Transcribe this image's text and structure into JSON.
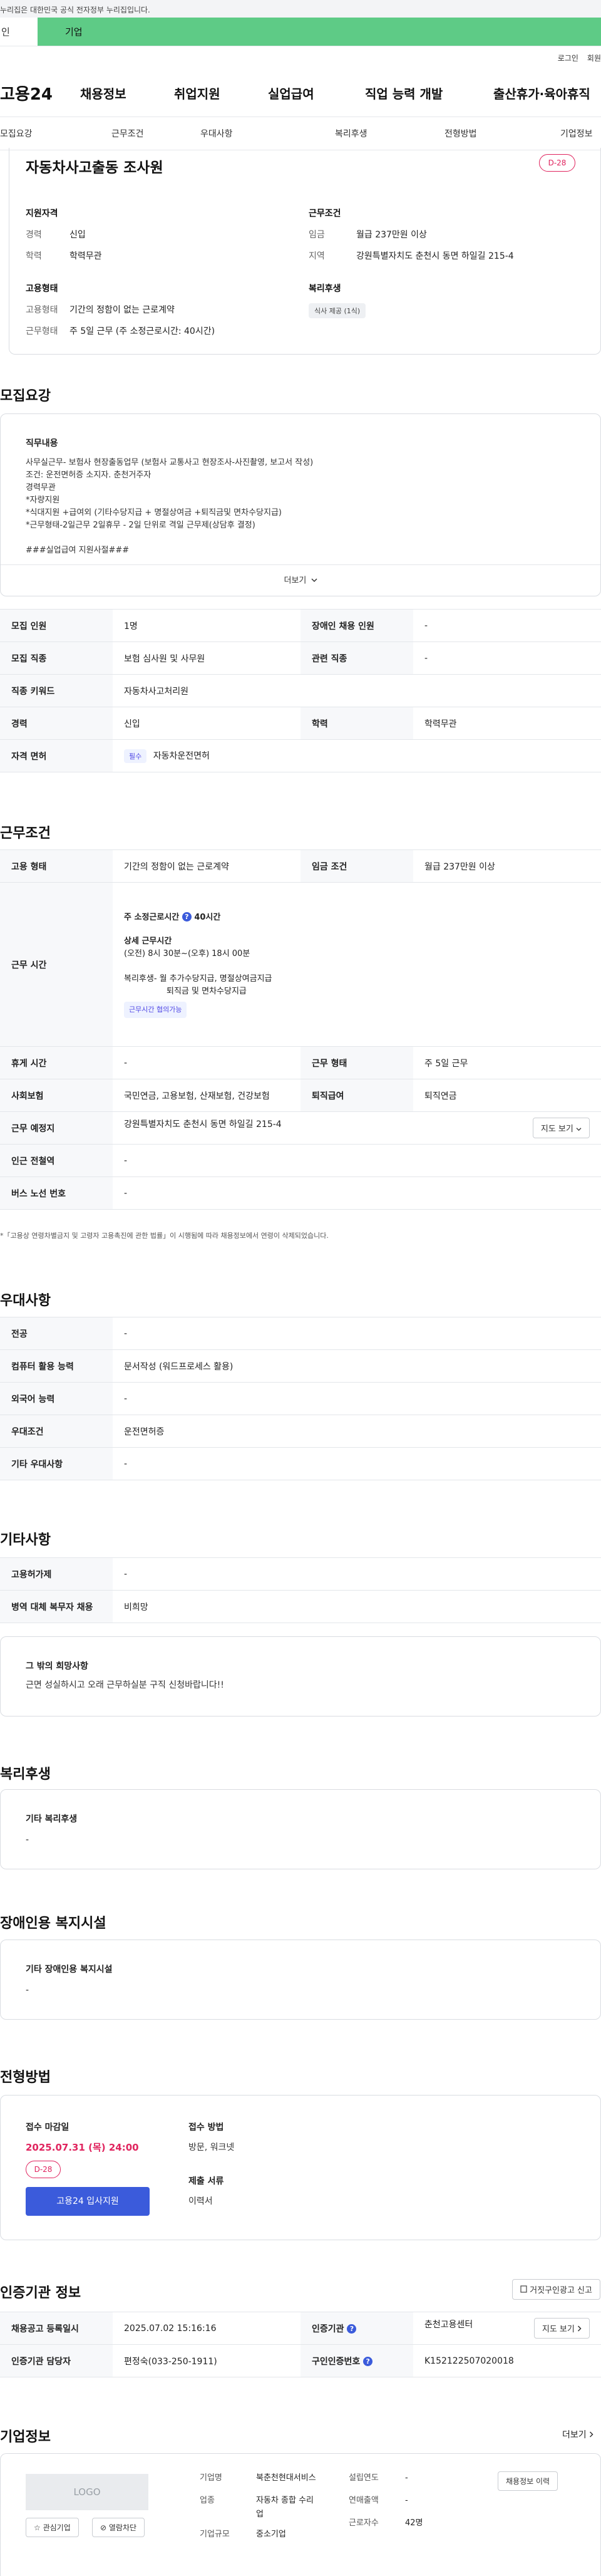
{
  "gov_notice": "누리집은 대한민국 공식 전자정부 누리집입니다.",
  "top_tabs": {
    "individual": "인",
    "company": "기업"
  },
  "util": {
    "login": "로그인",
    "join": "회원"
  },
  "gnb": {
    "logo": "고용24",
    "items": [
      "채용정보",
      "취업지원",
      "실업급여",
      "직업 능력 개발",
      "출산휴가·육아휴직"
    ]
  },
  "subnav": [
    "모집요강",
    "근무조건",
    "우대사항",
    "복리후생",
    "전형방법",
    "기업정보"
  ],
  "summary": {
    "title": "자동차사고출동 조사원",
    "dday": "D-28",
    "qual": {
      "heading": "지원자격",
      "rows": [
        {
          "k": "경력",
          "v": "신입"
        },
        {
          "k": "학력",
          "v": "학력무관"
        }
      ]
    },
    "cond": {
      "heading": "근무조건",
      "rows": [
        {
          "k": "임금",
          "v": "월급 237만원 이상"
        },
        {
          "k": "지역",
          "v": "강원특별자치도 춘천시 동면 하일길 215-4"
        }
      ]
    },
    "employ": {
      "heading": "고용형태",
      "rows": [
        {
          "k": "고용형태",
          "v": "기간의 정함이 없는 근로계약"
        },
        {
          "k": "근무형태",
          "v": "주 5일 근무 (주 소정근로시간: 40시간)"
        }
      ]
    },
    "welfare": {
      "heading": "복리후생",
      "chip": "식사 제공 (1식)"
    }
  },
  "recruit": {
    "title": "모집요강",
    "duty_heading": "직무내용",
    "duty_lines": [
      "사무실근무- 보험사 현장출동업무 (보험사 교통사고 현장조사-사진촬영, 보고서 작성)",
      "조건: 운전면허증 소지자. 춘천거주자",
      "경력무관",
      "*자량지원",
      "*식대지원 +급여외 (기타수당지급 + 명절상여금 +퇴직금및 면차수당지급)",
      "*근무형태-2일근무 2일휴무 - 2일 단위로 격일 근무제(상담후 결정)",
      "",
      "###실업급여 지원사절###"
    ],
    "more": "더보기",
    "table": [
      {
        "k1": "모집 인원",
        "v1": "1명",
        "k2": "장애인 채용 인원",
        "v2": "-"
      },
      {
        "k1": "모집 직종",
        "v1": "보험 심사원 및 사무원",
        "k2": "관련 직종",
        "v2": "-"
      },
      {
        "k1": "직종 키워드",
        "v1": "자동차사고처리원"
      },
      {
        "k1": "경력",
        "v1": "신입",
        "k2": "학력",
        "v2": "학력무관"
      },
      {
        "k1": "자격 면허",
        "badge": "필수",
        "v1": "자동차운전면허"
      }
    ]
  },
  "work": {
    "title": "근무조건",
    "employ_k": "고용 형태",
    "employ_v": "기간의 정함이 없는 근로계약",
    "wage_k": "임금 조건",
    "wage_v": "월급 237만원 이상",
    "hours_k": "근무 시간",
    "hours_weekly": "주 소정근로시간",
    "hours_weekly_val": "40시간",
    "hours_detail_heading": "상세 근무시간",
    "hours_detail": "(오전) 8시 30분~(오후) 18시 00분",
    "hours_welfare_1": "복리후생- 월 추가수당지급, 명절상여금지급",
    "hours_welfare_2": "퇴직금 및 면차수당지급",
    "hours_badge": "근무시간 협의가능",
    "rest_k": "휴게 시간",
    "rest_v": "-",
    "form_k": "근무 형태",
    "form_v": "주 5일 근무",
    "ins_k": "사회보험",
    "ins_v": "국민연금, 고용보험, 산재보험, 건강보험",
    "retire_k": "퇴직급여",
    "retire_v": "퇴직연금",
    "place_k": "근무 예정지",
    "place_v": "강원특별자치도 춘천시 동면 하일길 215-4",
    "map_btn": "지도 보기",
    "station_k": "인근 전철역",
    "station_v": "-",
    "bus_k": "버스 노선 번호",
    "bus_v": "-",
    "note": "*「고용상 연령차별금지 및 고령자 고용촉진에 관한 법률」이 시행됨에 따라 채용정보에서 연령이 삭제되었습니다."
  },
  "pref": {
    "title": "우대사항",
    "rows": [
      {
        "k": "전공",
        "v": "-"
      },
      {
        "k": "컴퓨터 활용 능력",
        "v": "문서작성 (워드프로세스 활용)"
      },
      {
        "k": "외국어 능력",
        "v": "-"
      },
      {
        "k": "우대조건",
        "v": "운전면허증"
      },
      {
        "k": "기타 우대사항",
        "v": "-"
      }
    ]
  },
  "etc": {
    "title": "기타사항",
    "rows": [
      {
        "k": "고용허가제",
        "v": "-"
      },
      {
        "k": "병역 대체 복무자 채용",
        "v": "비희망"
      }
    ],
    "hope_heading": "그 밖의 희망사항",
    "hope_text": "근면 성실하시고 오래 근무하실분 구직 신청바랍니다!!"
  },
  "welfare": {
    "title": "복리후생",
    "heading": "기타 복리후생",
    "value": "-"
  },
  "disabled": {
    "title": "장애인용 복지시설",
    "heading": "기타 장애인용 복지시설",
    "value": "-"
  },
  "process": {
    "title": "전형방법",
    "deadline_heading": "접수 마감일",
    "deadline": "2025.07.31 (목) 24:00",
    "dday": "D-28",
    "apply_btn": "고용24 입사지원",
    "method_heading": "접수 방법",
    "method": "방문, 워크넷",
    "docs_heading": "제출 서류",
    "docs": "이력서"
  },
  "cert": {
    "title": "인증기관 정보",
    "report_btn": "거짓구인광고 신고",
    "reg_k": "채용공고 등록일시",
    "reg_v": "2025.07.02 15:16:16",
    "org_k": "인증기관",
    "org_v": "춘천고용센터",
    "map_btn": "지도 보기",
    "mgr_k": "인증기관 담당자",
    "mgr_v": "편정숙(033-250-1911)",
    "no_k": "구인인증번호",
    "no_v": "K152122507020018"
  },
  "company": {
    "title": "기업정보",
    "more": "더보기",
    "logo": "LOGO",
    "interest_btn": "관심기업",
    "block_btn": "열람차단",
    "name_k": "기업명",
    "name_v": "북춘천현대서비스",
    "biz_k": "업종",
    "biz_v1": "자동차 종합 수리",
    "biz_v2": "업",
    "size_k": "기업규모",
    "size_v": "중소기업",
    "est_k": "설립연도",
    "est_v": "-",
    "sales_k": "연매출액",
    "sales_v": "-",
    "emp_k": "근로자수",
    "emp_v": "42명",
    "history_btn": "채용정보 이력"
  },
  "colors": {
    "accent": "#3b5bdb",
    "dday": "#e0245e",
    "green_tab": "#5ecb86"
  }
}
